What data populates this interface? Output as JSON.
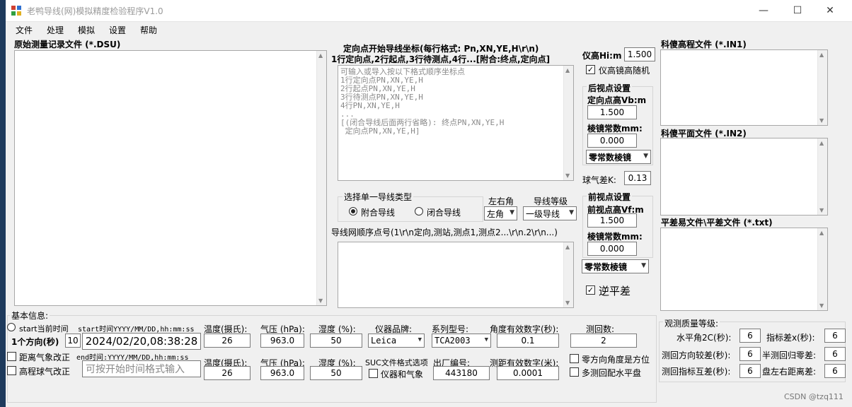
{
  "window": {
    "title": "老鸭导线(网)模拟精度检验程序V1.0",
    "controls": {
      "minimize": "—",
      "maximize": "☐",
      "close": "✕"
    }
  },
  "menu": [
    "文件",
    "处理",
    "模拟",
    "设置",
    "帮助"
  ],
  "raw_file": {
    "label": "原始测量记录文件 (*.DSU)"
  },
  "coords": {
    "label": "定向点开始导线坐标(每行格式: Pn,XN,YE,H\\r\\n)",
    "sublabel": "1行定向点,2行起点,3行待测点,4行...[附合:终点,定向点]",
    "placeholder": "可输入或导入按以下格式顺序坐标点\n1行定向点PN,XN,YE,H\n2行起点PN,XN,YE,H\n3行待测点PN,XN,YE,H\n4行PN,XN,YE,H\n...\n[(闭合导线后面两行省略): 终点PN,XN,YE,H\n 定向点PN,XN,YE,H]"
  },
  "instrument": {
    "height_label": "仪高Hi:m",
    "height_value": "1.500",
    "random_label": "仪高镜高随机",
    "random_checked": true
  },
  "back_sight": {
    "title": "后视点设置",
    "height_label": "定向点高Vb:m",
    "height_value": "1.500",
    "prism_label": "棱镜常数mm:",
    "prism_value": "0.000",
    "prism_mode": "零常数棱镜"
  },
  "refraction": {
    "label": "球气差K:",
    "value": "0.13"
  },
  "front_sight": {
    "title": "前视点设置",
    "height_label": "前视点高Vf:m",
    "height_value": "1.500",
    "prism_label": "棱镜常数mm:",
    "prism_value": "0.000",
    "prism_mode": "零常数棱镜"
  },
  "reverse_adjust": {
    "label": "逆平差",
    "checked": true
  },
  "traverse_type": {
    "title": "选择单一导线类型",
    "options": [
      "附合导线",
      "闭合导线"
    ],
    "selected": 0
  },
  "angle_side": {
    "label": "左右角",
    "value": "左角"
  },
  "grade": {
    "label": "导线等级",
    "value": "一级导线"
  },
  "sequence": {
    "label": "导线网顺序点号(1\\r\\n定向,测站,测点1,测点2...\\r\\n.2\\r\\n...)"
  },
  "right_files": {
    "in1": "科傻高程文件 (*.IN1)",
    "in2": "科傻平面文件 (*.IN2)",
    "txt": "平差易文件\\平差文件 (*.txt)"
  },
  "basic": {
    "title": "基本信息:",
    "start_now": "start当前时间",
    "start_fmt": "start时间YYYY/MM/DD,hh:mm:ss",
    "start_value": "2024/02/20,08:38:28",
    "direction_label": "1个方向(秒)",
    "direction_value": "10",
    "distance_correction": "距离气象改正",
    "elevation_correction": "高程球气改正",
    "end_fmt": "end时间:YYYY/MM/DD,hh:mm:ss",
    "end_placeholder": "可按开始时间格式输入"
  },
  "weather": {
    "temp_label": "温度(摄氏):",
    "temp1": "26",
    "pressure_label": "气压 (hPa):",
    "pressure1": "963.0",
    "humidity_label": "湿度 (%):",
    "humidity1": "50",
    "temp_label2": "温度(摄氏):",
    "temp2": "26",
    "pressure_label2": "气压 (hPa):",
    "pressure2": "963.0",
    "humidity_label2": "湿度 (%):",
    "humidity2": "50"
  },
  "device": {
    "brand_label": "仪器品牌:",
    "brand": "Leica",
    "model_label": "系列型号:",
    "model": "TCA2003",
    "suc_label": "SUC文件格式选项",
    "suc_option": "仪器和气象",
    "serial_label": "出厂编号:",
    "serial": "443180",
    "angle_digits_label": "角度有效数字(秒):",
    "angle_digits": "0.1",
    "dist_digits_label": "测距有效数字(米):",
    "dist_digits": "0.0001",
    "rounds_label": "测回数:",
    "rounds": "2",
    "zero_dir": "零方向角度是方位",
    "multi_round": "多测回配水平盘"
  },
  "quality": {
    "title": "观测质量等级:",
    "rows": [
      {
        "a_label": "水平角2C(秒):",
        "a_value": "6",
        "b_label": "指标差x(秒):",
        "b_value": "6"
      },
      {
        "a_label": "测回方向较差(秒):",
        "a_value": "6",
        "b_label": "半测回归零差:",
        "b_value": "6"
      },
      {
        "a_label": "测回指标互差(秒):",
        "a_value": "6",
        "b_label": "盘左右距离差:",
        "b_value": "6"
      }
    ]
  },
  "watermark": "CSDN @tzq111"
}
